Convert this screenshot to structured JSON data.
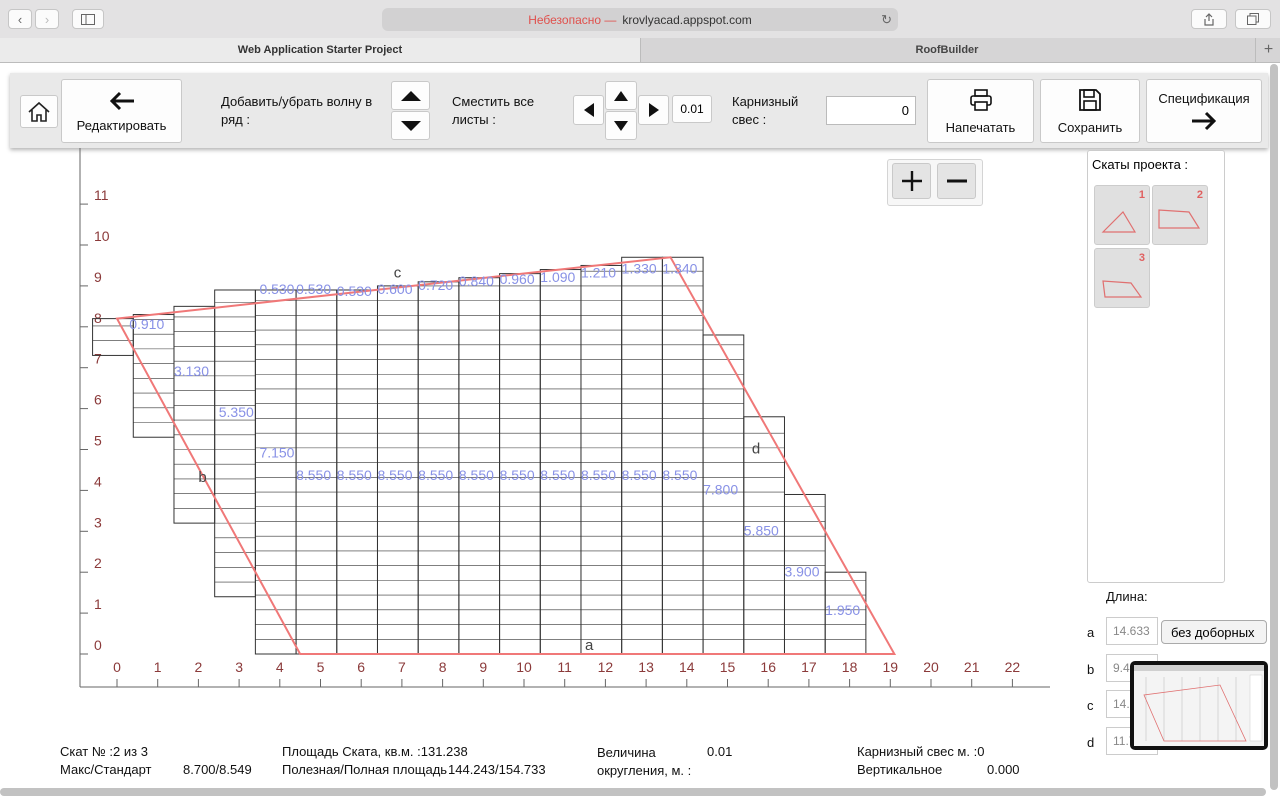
{
  "browser": {
    "url_warning": "Небезопасно —",
    "url_host": "krovlyacad.appspot.com",
    "tabs": [
      {
        "label": "Web Application Starter Project"
      },
      {
        "label": "RoofBuilder"
      }
    ]
  },
  "toolbar": {
    "edit_label": "Редактировать",
    "add_wave_label": "Добавить/убрать волну в ряд :",
    "shift_label": "Сместить все листы :",
    "step_value": "0.01",
    "eave_label": "Карнизный свес :",
    "eave_value": "0",
    "print_label": "Напечатать",
    "save_label": "Сохранить",
    "spec_label": "Спецификация"
  },
  "slopes": {
    "title": "Скаты проекта :",
    "items": [
      {
        "num": "1"
      },
      {
        "num": "2"
      },
      {
        "num": "3"
      }
    ]
  },
  "lengths": {
    "title": "Длина:",
    "rows": [
      {
        "side": "a",
        "value": "14.633",
        "option": "без доборных"
      },
      {
        "side": "b",
        "value": "9.4",
        "option": ""
      },
      {
        "side": "c",
        "value": "14.0",
        "option": ""
      },
      {
        "side": "d",
        "value": "11.7",
        "option": ""
      }
    ]
  },
  "status": {
    "slope_num": "Скат № :2 из 3",
    "max_std_label": "Макс/Стандарт",
    "max_std_value": "8.700/8.549",
    "area_label": "Площадь Ската, кв.м. :131.238",
    "useful_label": "Полезная/Полная площадь",
    "useful_value": "144.243/154.733",
    "rounding_label": "Величина округления, м. :",
    "rounding_value": "0.01",
    "eave_status": "Карнизный свес м. :0",
    "vertical_label": "Вертикальное",
    "vertical_value": "0.000"
  },
  "chart_data": {
    "type": "roof-layout",
    "x_ticks": [
      "0",
      "1",
      "2",
      "3",
      "4",
      "5",
      "6",
      "7",
      "8",
      "9",
      "10",
      "11",
      "12",
      "13",
      "14",
      "15",
      "16",
      "17",
      "18",
      "19",
      "20",
      "21",
      "22"
    ],
    "y_ticks": [
      "0",
      "1",
      "2",
      "3",
      "4",
      "5",
      "6",
      "7",
      "8",
      "9",
      "10",
      "11"
    ],
    "xlim": [
      0,
      22
    ],
    "ylim": [
      0,
      11
    ],
    "outline": [
      [
        4.5,
        0
      ],
      [
        19.1,
        0
      ],
      [
        13.6,
        9.7
      ],
      [
        0,
        8.2
      ]
    ],
    "outline_color": "#f07878",
    "grid_color": "#333333",
    "label_color": "#8891e6",
    "columns": [
      {
        "x0": -0.6,
        "x1": 0.4,
        "y0": 7.3,
        "y1": 8.2
      },
      {
        "x0": 0.4,
        "x1": 1.4,
        "y0": 5.3,
        "y1": 8.3
      },
      {
        "x0": 1.4,
        "x1": 2.4,
        "y0": 3.2,
        "y1": 8.5
      },
      {
        "x0": 2.4,
        "x1": 3.4,
        "y0": 1.4,
        "y1": 8.9
      },
      {
        "x0": 3.4,
        "x1": 4.4,
        "y0": 0,
        "y1": 8.9
      },
      {
        "x0": 4.4,
        "x1": 5.4,
        "y0": 0,
        "y1": 8.9
      },
      {
        "x0": 5.4,
        "x1": 6.4,
        "y0": 0,
        "y1": 8.9
      },
      {
        "x0": 6.4,
        "x1": 7.4,
        "y0": 0,
        "y1": 9.0
      },
      {
        "x0": 7.4,
        "x1": 8.4,
        "y0": 0,
        "y1": 9.1
      },
      {
        "x0": 8.4,
        "x1": 9.4,
        "y0": 0,
        "y1": 9.2
      },
      {
        "x0": 9.4,
        "x1": 10.4,
        "y0": 0,
        "y1": 9.3
      },
      {
        "x0": 10.4,
        "x1": 11.4,
        "y0": 0,
        "y1": 9.4
      },
      {
        "x0": 11.4,
        "x1": 12.4,
        "y0": 0,
        "y1": 9.5
      },
      {
        "x0": 12.4,
        "x1": 13.4,
        "y0": 0,
        "y1": 9.7
      },
      {
        "x0": 13.4,
        "x1": 14.4,
        "y0": 0,
        "y1": 9.7
      },
      {
        "x0": 14.4,
        "x1": 15.4,
        "y0": 0,
        "y1": 7.8
      },
      {
        "x0": 15.4,
        "x1": 16.4,
        "y0": 0,
        "y1": 5.8
      },
      {
        "x0": 16.4,
        "x1": 17.4,
        "y0": 0,
        "y1": 3.9
      },
      {
        "x0": 17.4,
        "x1": 18.4,
        "y0": 0,
        "y1": 2.0
      }
    ],
    "sheet_labels": [
      {
        "x": 0.3,
        "y": 7.95,
        "text": "0.910"
      },
      {
        "x": 1.4,
        "y": 6.8,
        "text": "3.130"
      },
      {
        "x": 2.5,
        "y": 5.8,
        "text": "5.350"
      },
      {
        "x": 3.5,
        "y": 4.8,
        "text": "7.150"
      },
      {
        "x": 3.5,
        "y": 8.8,
        "text": "0.530"
      },
      {
        "x": 4.4,
        "y": 8.8,
        "text": "0.530"
      },
      {
        "x": 5.4,
        "y": 8.75,
        "text": "0.530"
      },
      {
        "x": 6.4,
        "y": 8.8,
        "text": "0.600"
      },
      {
        "x": 7.4,
        "y": 8.9,
        "text": "0.720"
      },
      {
        "x": 8.4,
        "y": 9.0,
        "text": "0.840"
      },
      {
        "x": 9.4,
        "y": 9.05,
        "text": "0.960"
      },
      {
        "x": 10.4,
        "y": 9.1,
        "text": "1.090"
      },
      {
        "x": 11.4,
        "y": 9.2,
        "text": "1.210"
      },
      {
        "x": 12.4,
        "y": 9.3,
        "text": "1.330"
      },
      {
        "x": 13.4,
        "y": 9.3,
        "text": "1.340"
      },
      {
        "x": 4.4,
        "y": 4.25,
        "text": "8.550"
      },
      {
        "x": 5.4,
        "y": 4.25,
        "text": "8.550"
      },
      {
        "x": 6.4,
        "y": 4.25,
        "text": "8.550"
      },
      {
        "x": 7.4,
        "y": 4.25,
        "text": "8.550"
      },
      {
        "x": 8.4,
        "y": 4.25,
        "text": "8.550"
      },
      {
        "x": 9.4,
        "y": 4.25,
        "text": "8.550"
      },
      {
        "x": 10.4,
        "y": 4.25,
        "text": "8.550"
      },
      {
        "x": 11.4,
        "y": 4.25,
        "text": "8.550"
      },
      {
        "x": 12.4,
        "y": 4.25,
        "text": "8.550"
      },
      {
        "x": 13.4,
        "y": 4.25,
        "text": "8.550"
      },
      {
        "x": 14.4,
        "y": 3.9,
        "text": "7.800"
      },
      {
        "x": 15.4,
        "y": 2.9,
        "text": "5.850"
      },
      {
        "x": 16.4,
        "y": 1.9,
        "text": "3.900"
      },
      {
        "x": 17.4,
        "y": 0.95,
        "text": "1.950"
      }
    ],
    "side_labels": [
      {
        "x": 11.5,
        "y": 0.1,
        "text": "a"
      },
      {
        "x": 2.0,
        "y": 4.2,
        "text": "b"
      },
      {
        "x": 6.8,
        "y": 9.2,
        "text": "c"
      },
      {
        "x": 15.6,
        "y": 4.9,
        "text": "d"
      }
    ]
  }
}
